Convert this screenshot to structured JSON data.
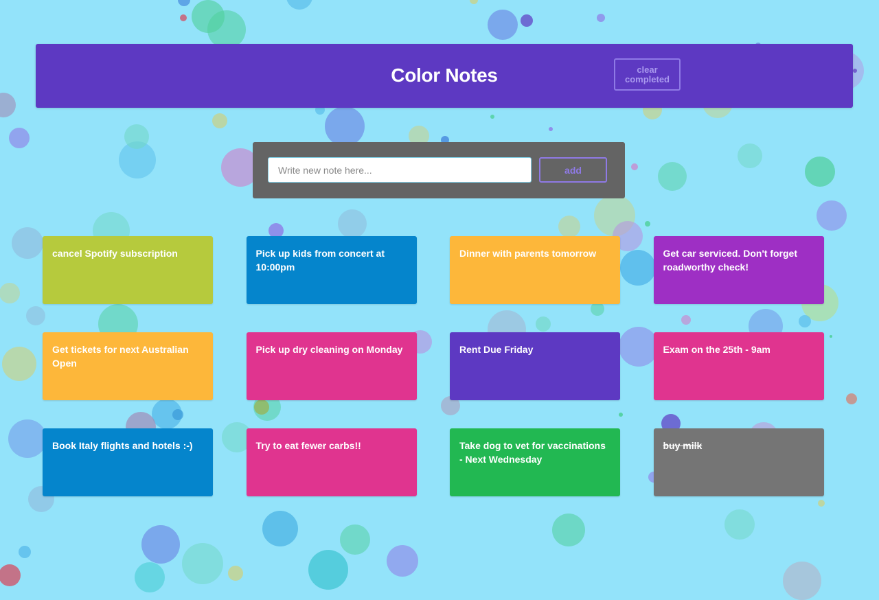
{
  "app": {
    "title": "Color Notes",
    "clear_label": "clear completed",
    "input_placeholder": "Write new note here...",
    "input_value": "",
    "add_label": "add"
  },
  "colors": {
    "background": "#93e3fa",
    "header": "#5d39c2",
    "composer": "#646464",
    "accent": "#8f7ae6"
  },
  "notes": [
    {
      "text": "cancel Spotify subscription",
      "color": "#b6ca3d",
      "completed": false
    },
    {
      "text": "Pick up kids from concert at 10:00pm",
      "color": "#0585cc",
      "completed": false
    },
    {
      "text": "Dinner with parents tomorrow",
      "color": "#fdb73a",
      "completed": false
    },
    {
      "text": "Get car serviced. Don't forget roadworthy check!",
      "color": "#9e2fc4",
      "completed": false
    },
    {
      "text": "Get tickets for next Australian Open",
      "color": "#fdb73a",
      "completed": false
    },
    {
      "text": "Pick up dry cleaning on Monday",
      "color": "#e0348f",
      "completed": false
    },
    {
      "text": "Rent Due Friday",
      "color": "#5d39c2",
      "completed": false
    },
    {
      "text": "Exam on the 25th - 9am",
      "color": "#e0348f",
      "completed": false
    },
    {
      "text": "Book Italy flights and hotels :-)",
      "color": "#0585cc",
      "completed": false
    },
    {
      "text": "Try to eat fewer carbs!!",
      "color": "#e0348f",
      "completed": false
    },
    {
      "text": "Take dog to vet for vaccinations - Next Wednesday",
      "color": "#22b852",
      "completed": false
    },
    {
      "text": "buy milk",
      "color": "#757575",
      "completed": true
    }
  ]
}
